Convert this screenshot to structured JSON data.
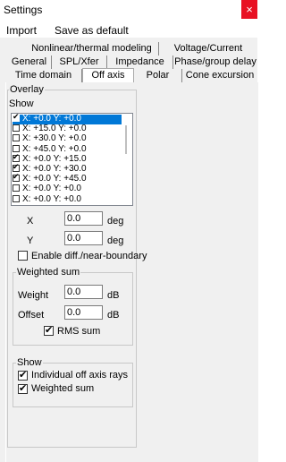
{
  "window": {
    "title": "Settings",
    "close_glyph": "×"
  },
  "menu": [
    "Import",
    "Save as default"
  ],
  "tabs": {
    "row1": [
      "Nonlinear/thermal modeling",
      "Voltage/Current"
    ],
    "row2": [
      "General",
      "SPL/Xfer",
      "Impedance",
      "Phase/group delay"
    ],
    "row3": [
      "Time domain",
      "Off axis",
      "Polar",
      "Cone excursion"
    ],
    "active": "Off axis"
  },
  "overlay": {
    "legend": "Overlay",
    "show_label": "Show",
    "items": [
      {
        "checked": true,
        "x": "+0.0",
        "y": "+0.0",
        "selected": true
      },
      {
        "checked": false,
        "x": "+15.0",
        "y": "+0.0",
        "selected": false
      },
      {
        "checked": false,
        "x": "+30.0",
        "y": "+0.0",
        "selected": false
      },
      {
        "checked": false,
        "x": "+45.0",
        "y": "+0.0",
        "selected": false
      },
      {
        "checked": true,
        "x": "+0.0",
        "y": "+15.0",
        "selected": false
      },
      {
        "checked": true,
        "x": "+0.0",
        "y": "+30.0",
        "selected": false
      },
      {
        "checked": true,
        "x": "+0.0",
        "y": "+45.0",
        "selected": false
      },
      {
        "checked": false,
        "x": "+0.0",
        "y": "+0.0",
        "selected": false
      },
      {
        "checked": false,
        "x": "+0.0",
        "y": "+0.0",
        "selected": false
      }
    ],
    "x_label": "X",
    "x_value": "0.0",
    "x_unit": "deg",
    "y_label": "Y",
    "y_value": "0.0",
    "y_unit": "deg",
    "enable_diff_label": "Enable diff./near-boundary",
    "enable_diff_checked": false
  },
  "weighted_sum": {
    "legend": "Weighted sum",
    "weight_label": "Weight",
    "weight_value": "0.0",
    "weight_unit": "dB",
    "offset_label": "Offset",
    "offset_value": "0.0",
    "offset_unit": "dB",
    "rms_label": "RMS sum",
    "rms_checked": true
  },
  "show_group": {
    "legend": "Show",
    "individual_label": "Individual off axis rays",
    "individual_checked": true,
    "weighted_label": "Weighted sum",
    "weighted_checked": true
  }
}
